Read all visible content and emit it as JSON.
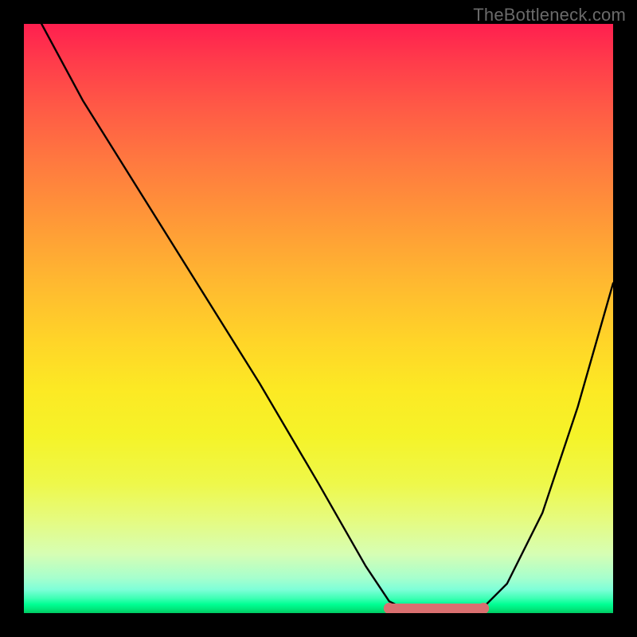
{
  "watermark": "TheBottleneck.com",
  "chart_data": {
    "type": "line",
    "title": "",
    "xlabel": "",
    "ylabel": "",
    "xlim": [
      0,
      100
    ],
    "ylim": [
      0,
      100
    ],
    "grid": false,
    "legend": false,
    "series": [
      {
        "name": "bottleneck-curve",
        "x": [
          3,
          10,
          20,
          30,
          40,
          50,
          58,
          62,
          66,
          70,
          74,
          78,
          82,
          88,
          94,
          100
        ],
        "y": [
          100,
          87,
          71,
          55,
          39,
          22,
          8,
          2,
          0,
          0,
          0,
          1,
          5,
          17,
          35,
          56
        ]
      },
      {
        "name": "bottleneck-flat-marker",
        "x": [
          62,
          78
        ],
        "y": [
          0,
          0
        ]
      }
    ],
    "background_gradient": {
      "top": "#ff1f4f",
      "mid": "#ffd528",
      "bottom": "#00c862"
    },
    "flat_marker_color": "#d97070",
    "annotations": []
  }
}
